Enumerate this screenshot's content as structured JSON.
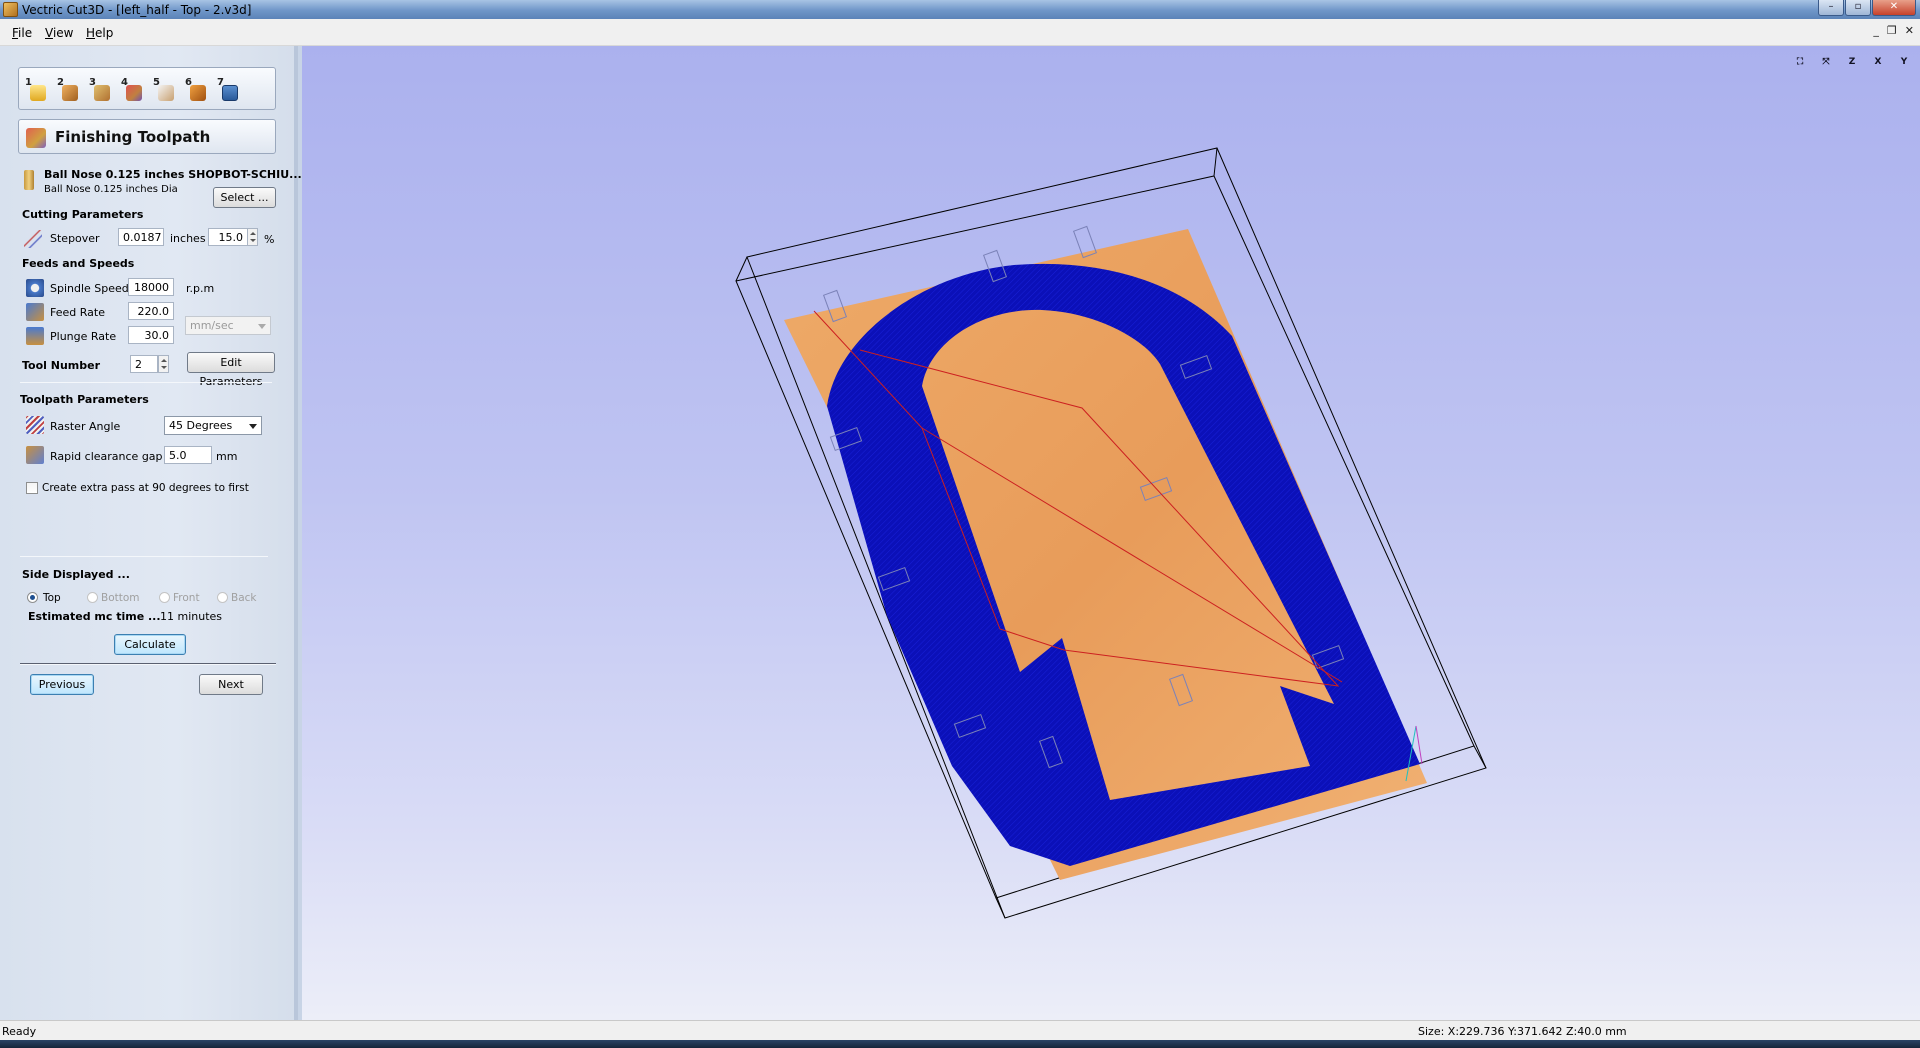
{
  "window": {
    "title": "Vectric Cut3D - [left_half - Top - 2.v3d]"
  },
  "menu": [
    {
      "label": "File",
      "key": "F",
      "rest": "ile"
    },
    {
      "label": "View",
      "key": "V",
      "rest": "iew"
    },
    {
      "label": "Help",
      "key": "H",
      "rest": "elp"
    }
  ],
  "wizard_steps": [
    "1",
    "2",
    "3",
    "4",
    "5",
    "6",
    "7"
  ],
  "panel": {
    "title": "Finishing Toolpath",
    "tool": {
      "name": "Ball Nose 0.125 inches SHOPBOT-SCHIU...",
      "desc": "Ball Nose 0.125 inches Dia",
      "select_label": "Select ..."
    },
    "cutting": {
      "heading": "Cutting Parameters",
      "stepover_label": "Stepover",
      "stepover_value": "0.0187",
      "stepover_unit": "inches",
      "stepover_percent": "15.0",
      "percent_sign": "%"
    },
    "feeds": {
      "heading": "Feeds and Speeds",
      "spindle_label": "Spindle Speed",
      "spindle_value": "18000",
      "spindle_unit": "r.p.m",
      "feed_label": "Feed Rate",
      "feed_value": "220.0",
      "plunge_label": "Plunge Rate",
      "plunge_value": "30.0",
      "rate_unit": "mm/sec",
      "tool_number_label": "Tool Number",
      "tool_number_value": "2",
      "edit_params_label": "Edit Parameters"
    },
    "toolpath": {
      "heading": "Toolpath Parameters",
      "raster_label": "Raster Angle",
      "raster_value": "45 Degrees",
      "clearance_label": "Rapid clearance gap",
      "clearance_value": "5.0",
      "clearance_unit": "mm",
      "extra_pass_label": "Create extra pass at 90 degrees to first",
      "extra_pass_checked": false
    },
    "side": {
      "heading": "Side Displayed ...",
      "options": [
        "Top",
        "Bottom",
        "Front",
        "Back"
      ],
      "selected": "Top",
      "estimate_label": "Estimated mc time ...",
      "estimate_value": "11 minutes",
      "calculate_label": "Calculate"
    },
    "nav": {
      "previous_label": "Previous",
      "next_label": "Next"
    }
  },
  "viewport": {
    "view_tools": [
      "fit",
      "iso",
      "Z",
      "X",
      "Y"
    ],
    "colors": {
      "material": "#e8a060",
      "toolpath": "#0a0fb0",
      "rapid": "#cc2020",
      "bbox": "#000000"
    }
  },
  "status": {
    "left": "Ready",
    "right": "Size: X:229.736 Y:371.642 Z:40.0 mm"
  }
}
